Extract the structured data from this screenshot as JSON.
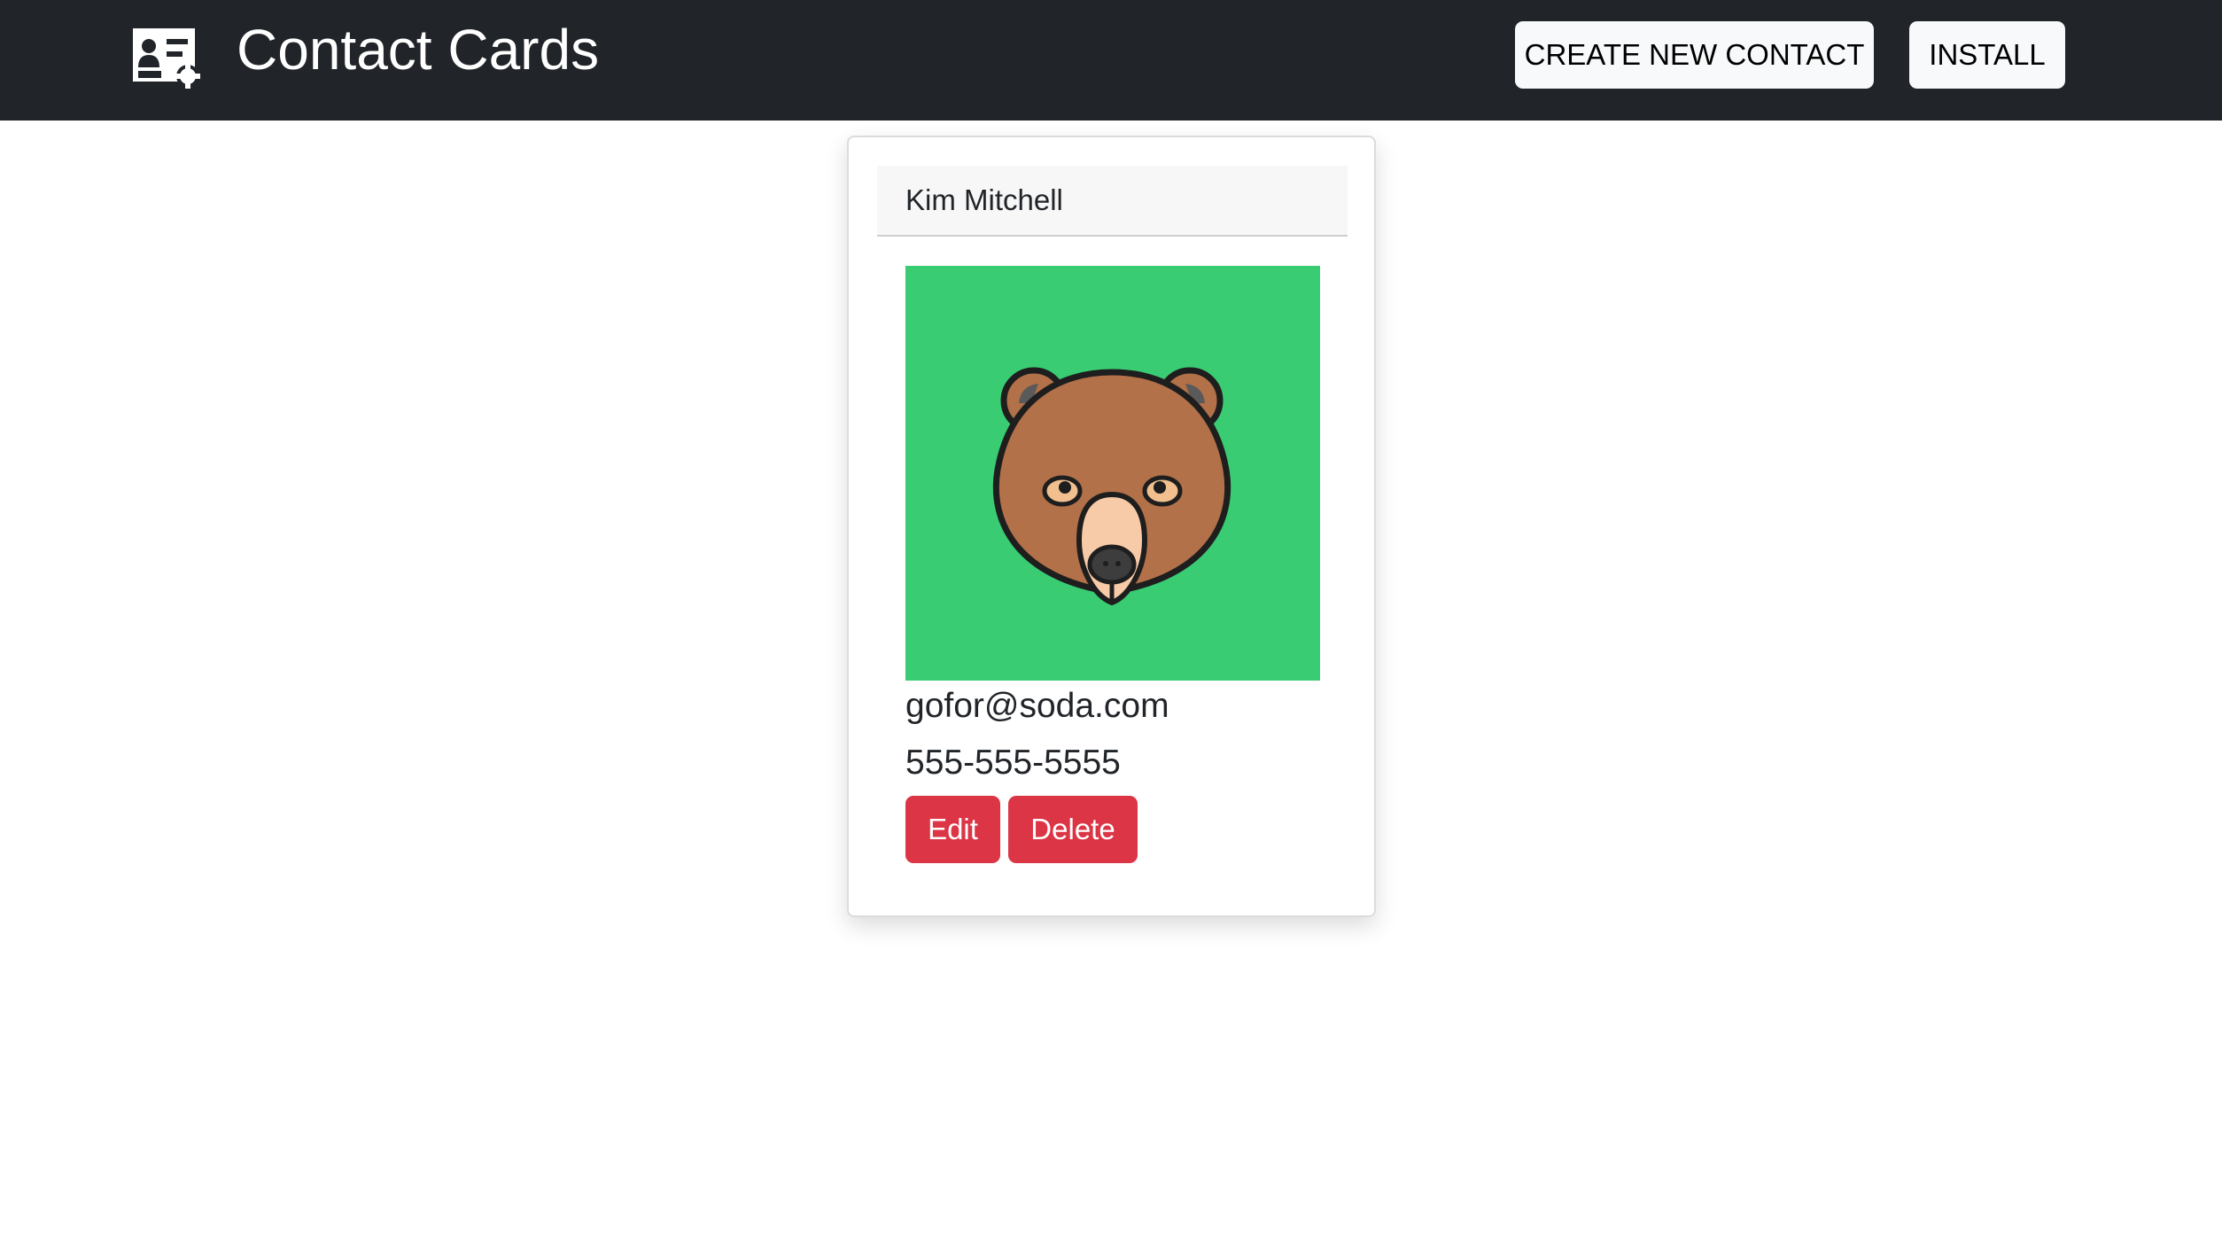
{
  "header": {
    "title": "Contact Cards",
    "logo_icon": "contact-card-icon",
    "create_button": "CREATE NEW CONTACT",
    "install_button": "INSTALL"
  },
  "contact": {
    "name": "Kim Mitchell",
    "avatar_icon": "bear-icon",
    "email": "gofor@soda.com",
    "phone": "555-555-5555",
    "edit_label": "Edit",
    "delete_label": "Delete"
  },
  "colors": {
    "navbar": "#212529",
    "avatar_background": "#3acc73",
    "danger": "#dc3545"
  }
}
